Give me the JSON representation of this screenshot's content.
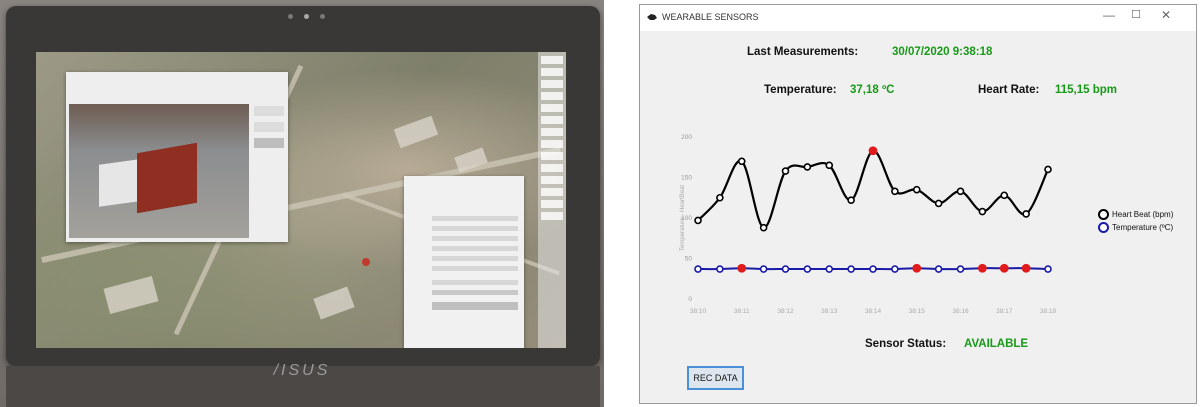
{
  "photo": {
    "brand_text": "/ISUS"
  },
  "app": {
    "window_title": "WEARABLE SENSORS",
    "controls": {
      "minimize": "—",
      "maximize": "☐",
      "close": "✕"
    },
    "last_measurements_label": "Last Measurements:",
    "last_measurements_value": "30/07/2020 9:38:18",
    "temperature_label": "Temperature:",
    "temperature_value": "37,18 ºC",
    "heart_rate_label": "Heart Rate:",
    "heart_rate_value": "115,15 bpm",
    "sensor_status_label": "Sensor Status:",
    "sensor_status_value": "AVAILABLE",
    "rec_button_label": "REC DATA",
    "value_color": "#189a18"
  },
  "chart_data": {
    "type": "line",
    "ylabel": "Temperature - HeartBeat",
    "xlabel": "",
    "ylim": [
      0,
      200
    ],
    "yticks": [
      0,
      50,
      100,
      150,
      200
    ],
    "x_ticks": [
      "38:10",
      "38:11",
      "38:12",
      "38:13",
      "38:14",
      "38:15",
      "38:16",
      "38:17",
      "38:18"
    ],
    "x": [
      0,
      0.5,
      1,
      1.5,
      2,
      2.5,
      3,
      3.5,
      4,
      4.5,
      5,
      5.5,
      6,
      6.5,
      7,
      7.5,
      8
    ],
    "series": [
      {
        "name": "Heart Beat (bpm)",
        "color": "#000000",
        "values": [
          97,
          125,
          170,
          88,
          158,
          163,
          165,
          122,
          183,
          133,
          135,
          118,
          133,
          108,
          128,
          105,
          160
        ],
        "highlight": [
          8
        ]
      },
      {
        "name": "Temperature (ºC)",
        "color": "#1a1aa8",
        "values": [
          37,
          37,
          38,
          37,
          37,
          37,
          37,
          37,
          37,
          37,
          38,
          37,
          37,
          38,
          38,
          38,
          37
        ],
        "highlight": [
          2,
          10,
          13,
          14,
          15
        ]
      }
    ],
    "highlight_color": "#e01b1b",
    "legend": "right",
    "grid": false
  }
}
